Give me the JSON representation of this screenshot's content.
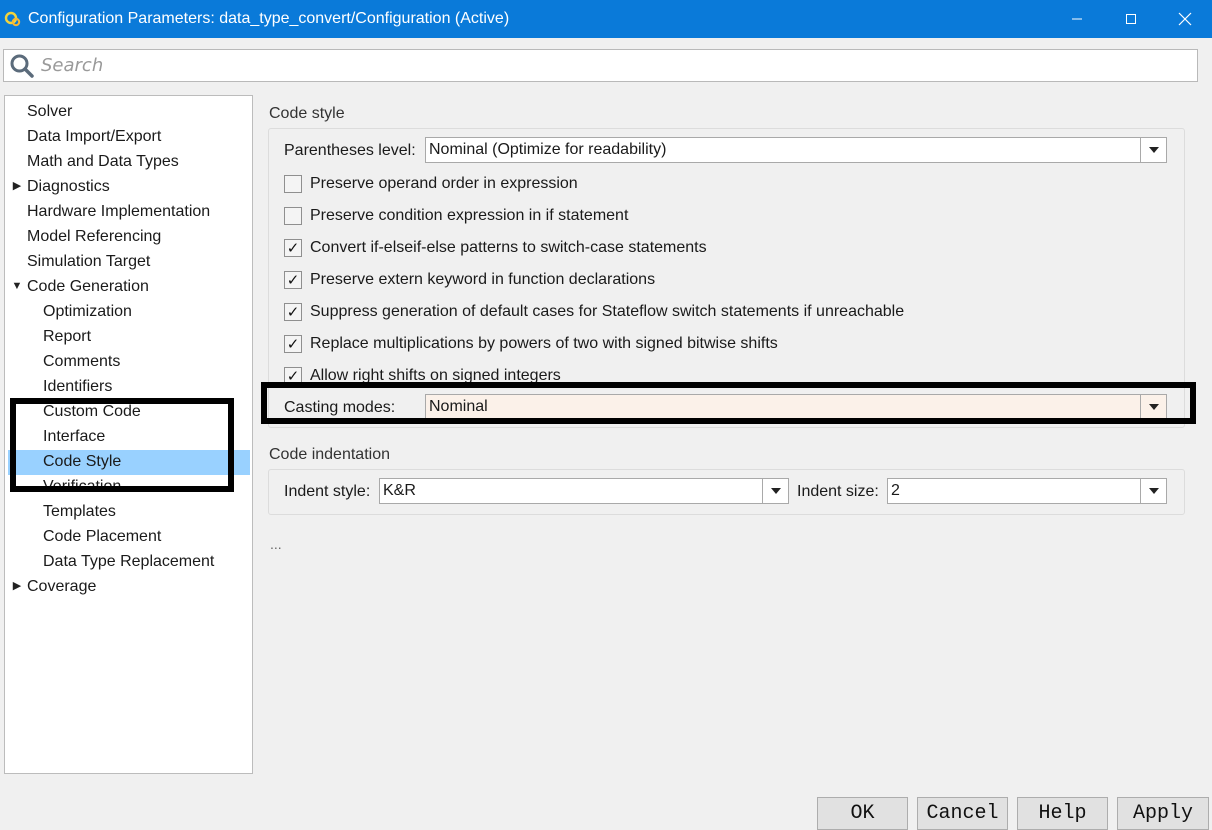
{
  "window": {
    "title": "Configuration Parameters: data_type_convert/Configuration (Active)"
  },
  "search": {
    "placeholder": "Search"
  },
  "tree": {
    "items": [
      {
        "label": "Solver"
      },
      {
        "label": "Data Import/Export"
      },
      {
        "label": "Math and Data Types"
      },
      {
        "label": "Diagnostics"
      },
      {
        "label": "Hardware Implementation"
      },
      {
        "label": "Model Referencing"
      },
      {
        "label": "Simulation Target"
      },
      {
        "label": "Code Generation"
      },
      {
        "label": "Optimization"
      },
      {
        "label": "Report"
      },
      {
        "label": "Comments"
      },
      {
        "label": "Identifiers"
      },
      {
        "label": "Custom Code"
      },
      {
        "label": "Interface"
      },
      {
        "label": "Code Style"
      },
      {
        "label": "Verification"
      },
      {
        "label": "Templates"
      },
      {
        "label": "Code Placement"
      },
      {
        "label": "Data Type Replacement"
      },
      {
        "label": "Coverage"
      }
    ],
    "selected": "Code Style"
  },
  "code_style": {
    "section_title": "Code style",
    "parentheses_label": "Parentheses level:",
    "parentheses_value": "Nominal (Optimize for readability)",
    "checkboxes": [
      {
        "label": "Preserve operand order in expression",
        "checked": false
      },
      {
        "label": "Preserve condition expression in if statement",
        "checked": false
      },
      {
        "label": "Convert if-elseif-else patterns to switch-case statements",
        "checked": true
      },
      {
        "label": "Preserve extern keyword in function declarations",
        "checked": true
      },
      {
        "label": "Suppress generation of default cases for Stateflow switch statements if unreachable",
        "checked": true
      },
      {
        "label": "Replace multiplications by powers of two with signed bitwise shifts",
        "checked": true
      },
      {
        "label": "Allow right shifts on signed integers",
        "checked": true
      }
    ],
    "casting_label": "Casting modes:",
    "casting_value": "Nominal"
  },
  "code_indentation": {
    "section_title": "Code indentation",
    "indent_style_label": "Indent style:",
    "indent_style_value": "K&R",
    "indent_size_label": "Indent size:",
    "indent_size_value": "2"
  },
  "more": "...",
  "buttons": {
    "ok": "OK",
    "cancel": "Cancel",
    "help": "Help",
    "apply": "Apply"
  },
  "colors": {
    "titlebar": "#0a7ad9",
    "selection": "#99d1ff",
    "casting_bg": "#fbf1e9"
  }
}
